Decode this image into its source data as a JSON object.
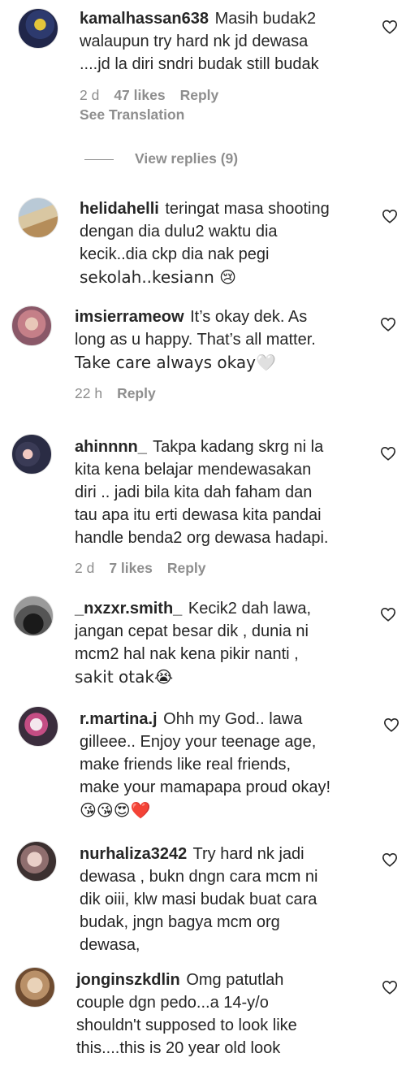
{
  "comments": [
    {
      "username": "kamalhassan638",
      "line_texts": [
        "Masih budak2",
        "walaupun try hard nk jd dewasa",
        "....jd la diri sndri budak still budak"
      ],
      "time": "2 d",
      "likes": "47 likes",
      "reply": "Reply",
      "see_translation": "See Translation",
      "view_replies": "View replies (9)"
    },
    {
      "username": "helidahelli",
      "line_texts": [
        "teringat masa shooting",
        "dengan dia dulu2 waktu dia",
        "kecik..dia ckp dia nak pegi",
        "sekolah..kesiann 😢"
      ]
    },
    {
      "username": "imsierrameow",
      "line_texts": [
        "It’s okay dek. As",
        "long as u happy. That’s all matter.",
        "Take care always okay🤍"
      ],
      "time": "22 h",
      "reply": "Reply"
    },
    {
      "username": "ahinnnn_",
      "line_texts": [
        "Takpa kadang skrg ni la",
        "kita kena belajar mendewasakan",
        "diri .. jadi bila kita dah faham dan",
        "tau apa itu erti dewasa kita pandai",
        "handle benda2 org dewasa hadapi."
      ],
      "time": "2 d",
      "likes": "7 likes",
      "reply": "Reply"
    },
    {
      "username": "_nxzxr.smith_",
      "line_texts": [
        "Kecik2 dah lawa,",
        "jangan cepat besar dik , dunia ni",
        "mcm2 hal nak kena pikir nanti ,",
        "sakit otak😭"
      ]
    },
    {
      "username": "r.martina.j",
      "line_texts": [
        "Ohh my God.. lawa",
        "gilleee.. Enjoy your teenage age,",
        "make friends like real friends,",
        "make your mamapapa proud okay!",
        "😘😘😍❤️"
      ]
    },
    {
      "username": "nurhaliza3242",
      "line_texts": [
        "Try hard nk jadi",
        "dewasa , bukn dngn cara mcm ni",
        "dik oiii, klw masi budak buat cara",
        "budak, jngn bagya mcm org",
        "dewasa,"
      ]
    },
    {
      "username": "jonginszkdlin",
      "line_texts": [
        "Omg patutlah",
        "couple dgn pedo...a 14-y/o",
        "shouldn't supposed to look like",
        "this....this is 20 year old look"
      ]
    }
  ],
  "colors": {
    "text": "#262626",
    "secondary": "#8e8e8e",
    "background": "#ffffff"
  },
  "icons": {
    "like": "heart-outline-icon"
  }
}
